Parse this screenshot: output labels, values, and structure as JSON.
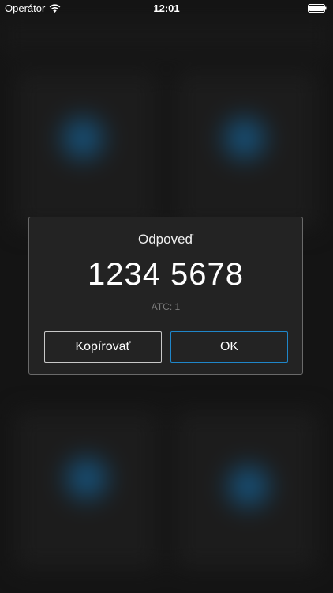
{
  "status_bar": {
    "carrier": "Operátor",
    "time": "12:01",
    "wifi_icon": "wifi-icon",
    "battery_icon": "battery-icon"
  },
  "dialog": {
    "title": "Odpoveď",
    "code": "1234 5678",
    "atc": "ATC: 1",
    "copy_label": "Kopírovať",
    "ok_label": "OK"
  },
  "colors": {
    "accent": "#1f86c9",
    "dialog_bg": "#232323",
    "muted_text": "#7c7c7c"
  }
}
